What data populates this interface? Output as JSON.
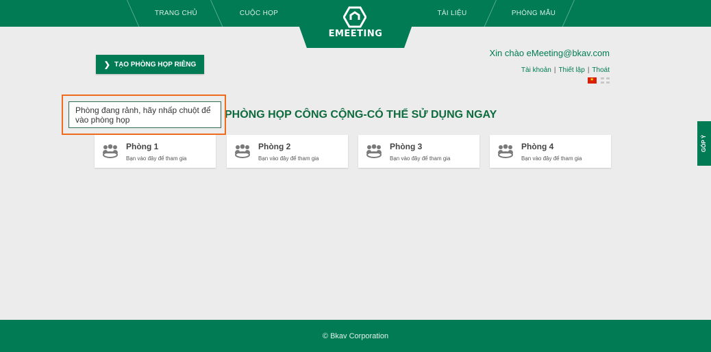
{
  "nav": {
    "items": [
      {
        "label": "TRANG CHỦ"
      },
      {
        "label": "CUỘC HỌP"
      },
      {
        "label": "TÀI LIỆU"
      },
      {
        "label": "PHÒNG MẪU"
      }
    ],
    "logo_text": "EMEETING"
  },
  "create_button": {
    "label": "TẠO PHÒNG HỌP RIÊNG",
    "icon": "chevron-right-icon"
  },
  "user": {
    "greeting": "Xin chào eMeeting@bkav.com",
    "links": {
      "account": "Tài khoản",
      "settings": "Thiết lập",
      "logout": "Thoát"
    },
    "languages": [
      "vietnamese-flag-icon",
      "uk-flag-icon"
    ]
  },
  "section_title": "PHÒNG HỌP CÔNG CỘNG-CÓ THỂ SỬ DỤNG NGAY",
  "tooltip": "Phòng đang rảnh, hãy nhấp chuột để vào phòng họp",
  "rooms": [
    {
      "name": "Phòng 1",
      "subtitle": "Bạn vào đây để tham gia"
    },
    {
      "name": "Phòng 2",
      "subtitle": "Bạn vào đây để tham gia"
    },
    {
      "name": "Phòng 3",
      "subtitle": "Bạn vào đây để tham gia"
    },
    {
      "name": "Phòng 4",
      "subtitle": "Bạn vào đây để tham gia"
    }
  ],
  "feedback_label": "GÓP Ý",
  "footer": "© Bkav Corporation",
  "colors": {
    "brand": "#007b53",
    "highlight": "#f06a1d",
    "background": "#ececec"
  }
}
